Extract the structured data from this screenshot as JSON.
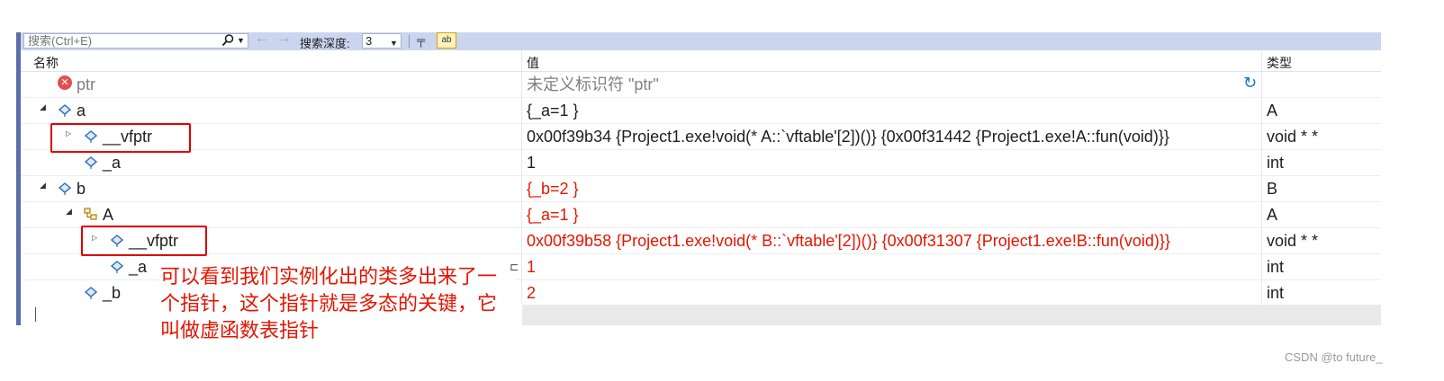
{
  "toolbar": {
    "search_placeholder": "搜索(Ctrl+E)",
    "search_icon": "search-icon",
    "back_icon": "←",
    "forward_icon": "→",
    "depth_label": "搜索深度:",
    "depth_value": "3",
    "pin_icon": "pin-icon",
    "ab_label": "ab"
  },
  "columns": {
    "name": "名称",
    "value": "值",
    "type": "类型"
  },
  "rows": [
    {
      "name": "ptr",
      "value": "未定义标识符 \"ptr\"",
      "type": ""
    },
    {
      "name": "a",
      "value": "{_a=1 }",
      "type": "A"
    },
    {
      "name": "__vfptr",
      "value": "0x00f39b34 {Project1.exe!void(* A::`vftable'[2])()} {0x00f31442 {Project1.exe!A::fun(void)}}",
      "type": "void * *"
    },
    {
      "name": "_a",
      "value": "1",
      "type": "int"
    },
    {
      "name": "b",
      "value": "{_b=2 }",
      "type": "B"
    },
    {
      "name": "A",
      "value": "{_a=1 }",
      "type": "A"
    },
    {
      "name": "__vfptr",
      "value": "0x00f39b58 {Project1.exe!void(* B::`vftable'[2])()} {0x00f31307 {Project1.exe!B::fun(void)}}",
      "type": "void * *"
    },
    {
      "name": "_a",
      "value": "1",
      "type": "int"
    },
    {
      "name": "_b",
      "value": "2",
      "type": "int"
    }
  ],
  "annotation": "可以看到我们实例化出的类多出来了一个指针，这个指针就是多态的关键，它叫做虚函数表指针",
  "watermark": "CSDN @to future_",
  "colors": {
    "changed_value": "#e51400",
    "highlight_box": "#e00000",
    "toolbar_bg": "#ccd5f0"
  }
}
